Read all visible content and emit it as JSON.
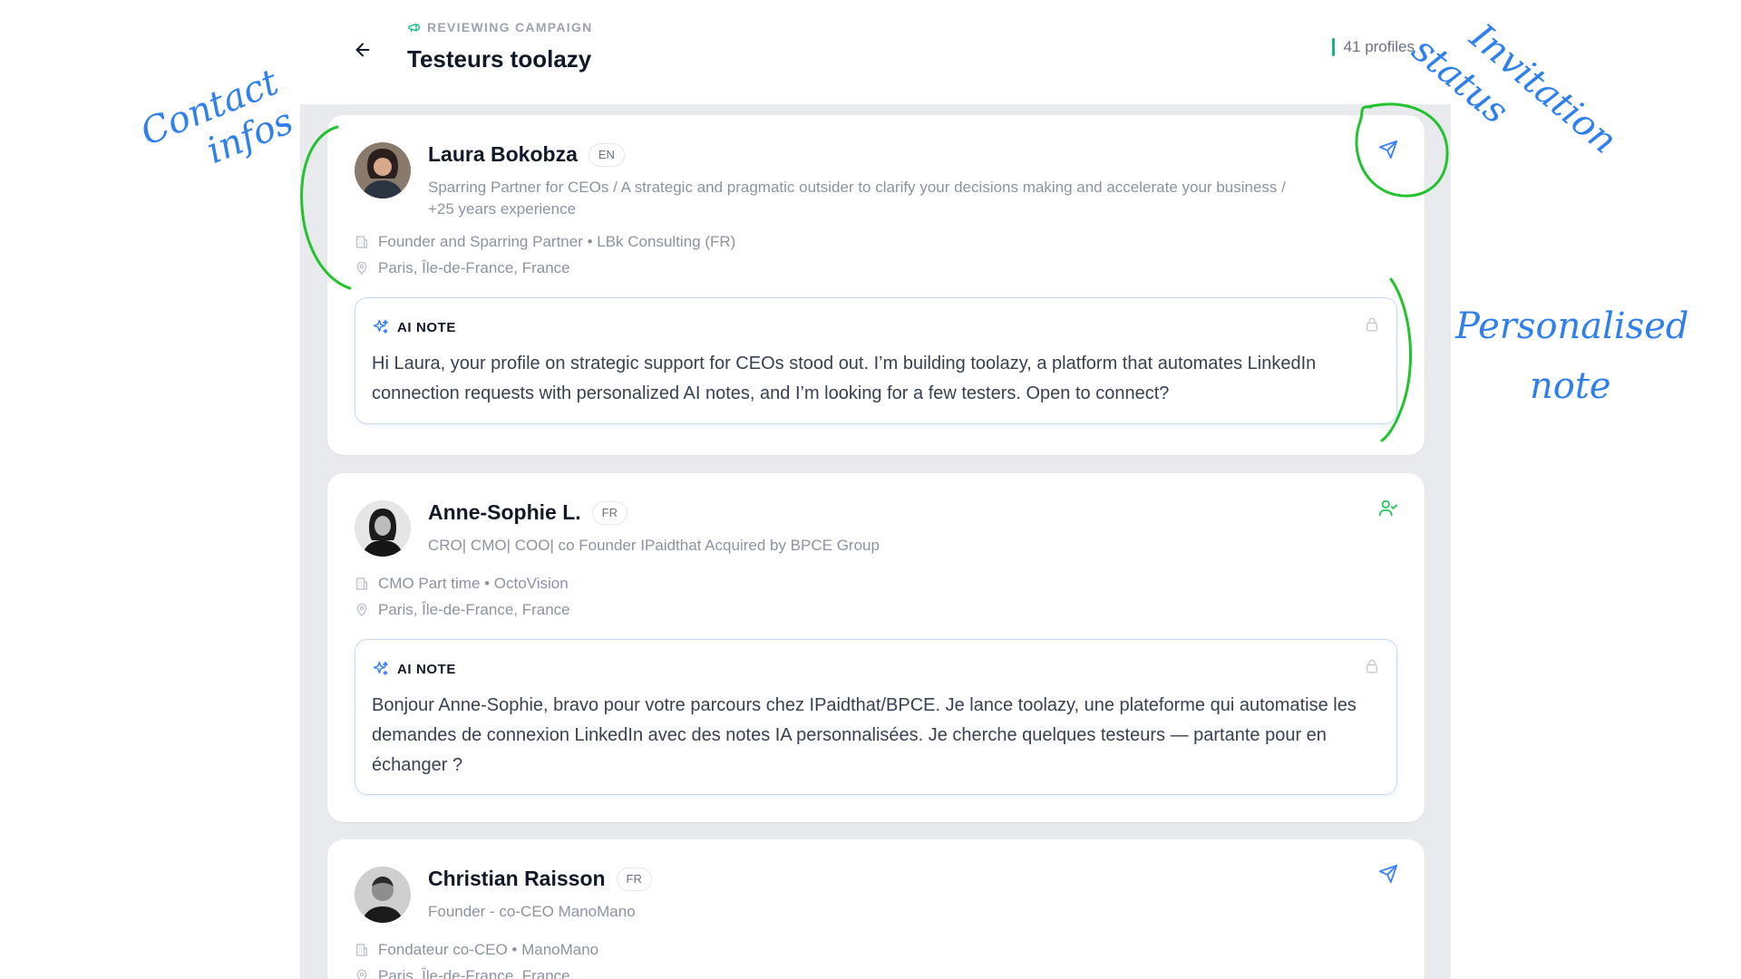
{
  "header": {
    "eyebrow": "REVIEWING CAMPAIGN",
    "title": "Testeurs toolazy",
    "profile_count": "41 profiles"
  },
  "profiles": [
    {
      "name": "Laura Bokobza",
      "lang": "EN",
      "headline": "Sparring Partner for CEOs / A strategic and pragmatic outsider to clarify your decisions making and accelerate your business / +25 years experience",
      "position": "Founder and Sparring Partner • LBk Consulting (FR)",
      "location": "Paris, Île-de-France, France",
      "status_icon": "send-icon",
      "note_label": "AI NOTE",
      "note": "Hi Laura, your profile on strategic support for CEOs stood out. I’m building toolazy, a platform that automates LinkedIn connection requests with personalized AI notes, and I’m looking for a few testers. Open to connect?"
    },
    {
      "name": "Anne-Sophie L.",
      "lang": "FR",
      "headline": "CRO| CMO| COO| co Founder IPaidthat Acquired by BPCE Group",
      "position": "CMO Part time • OctoVision",
      "location": "Paris, Île-de-France, France",
      "status_icon": "user-check-icon",
      "note_label": "AI NOTE",
      "note": "Bonjour Anne-Sophie, bravo pour votre parcours chez IPaidthat/BPCE. Je lance toolazy, une plateforme qui automatise les demandes de connexion LinkedIn avec des notes IA personnalisées. Je cherche quelques testeurs — partante pour en échanger ?"
    },
    {
      "name": "Christian Raisson",
      "lang": "FR",
      "headline": "Founder - co-CEO ManoMano",
      "position": "Fondateur co-CEO • ManoMano",
      "location": "Paris, Île-de-France, France",
      "status_icon": "send-icon"
    }
  ],
  "annotations": {
    "contact_line1": "Contact",
    "contact_line2": "infos",
    "invitation_line1": "Invitation",
    "invitation_line2": "status",
    "note_line1": "Personalised",
    "note_line2": "note"
  },
  "colors": {
    "accent_blue": "#3b82f6",
    "accepted_green": "#22c55e",
    "annotation_green": "#22c32f",
    "annotation_blue": "#2f80ed"
  }
}
